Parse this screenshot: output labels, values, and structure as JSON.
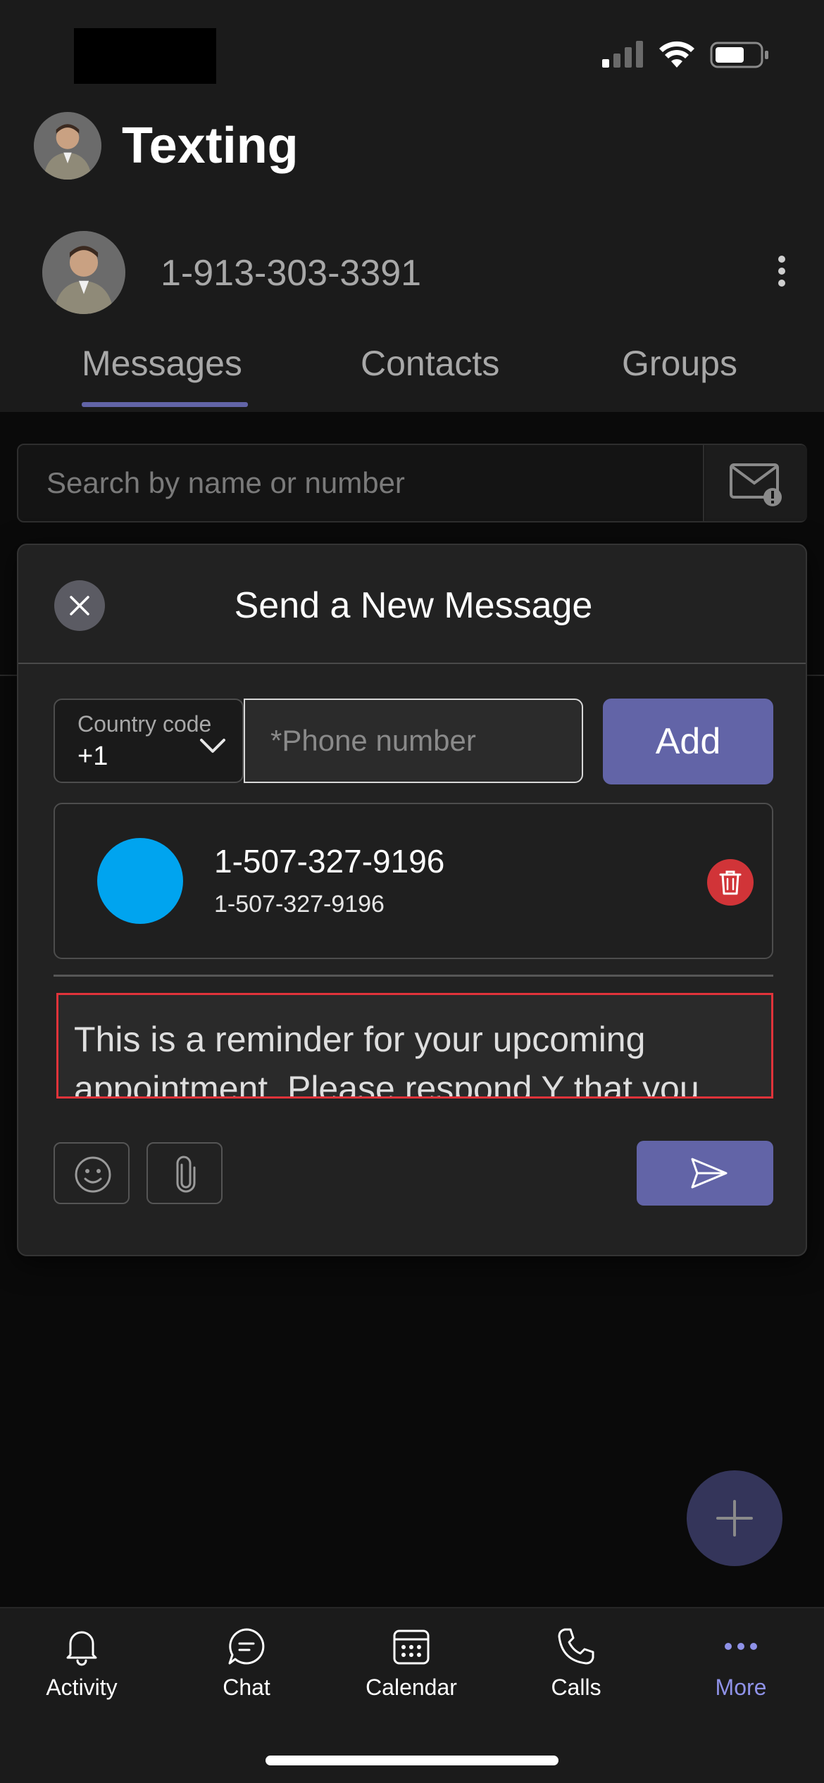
{
  "app": {
    "title": "Texting"
  },
  "account": {
    "phone_number": "1-913-303-3391"
  },
  "tabs": [
    {
      "label": "Messages",
      "active": true
    },
    {
      "label": "Contacts",
      "active": false
    },
    {
      "label": "Groups",
      "active": false
    }
  ],
  "search": {
    "placeholder": "Search by name or number"
  },
  "dialog": {
    "title": "Send a New Message",
    "country_code_label": "Country code",
    "country_code_value": "+1",
    "phone_placeholder": "*Phone number",
    "add_label": "Add",
    "recipient": {
      "name": "1-507-327-9196",
      "number": "1-507-327-9196",
      "avatar_color": "#00a4ef"
    },
    "message": "This is a reminder for your upcoming appointment. Please respond Y that you can make it or N to reschedule."
  },
  "nav": {
    "items": [
      {
        "label": "Activity",
        "icon": "bell-icon",
        "active": false
      },
      {
        "label": "Chat",
        "icon": "chat-icon",
        "active": false
      },
      {
        "label": "Calendar",
        "icon": "calendar-icon",
        "active": false
      },
      {
        "label": "Calls",
        "icon": "phone-icon",
        "active": false
      },
      {
        "label": "More",
        "icon": "more-horizontal-icon",
        "active": true
      }
    ]
  },
  "colors": {
    "accent": "#6264a7",
    "active_nav": "#8f92e8",
    "delete": "#d13438",
    "highlight_border": "#e0333a"
  }
}
